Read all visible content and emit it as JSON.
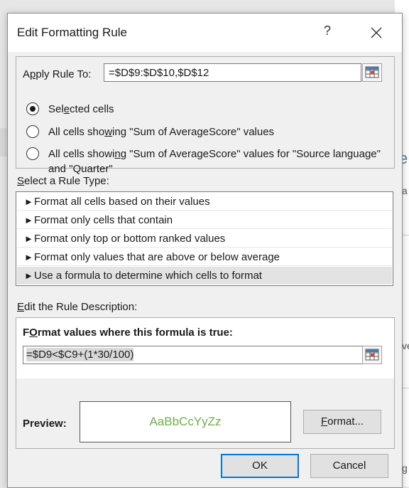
{
  "dialog": {
    "title": "Edit Formatting Rule",
    "help_label": "?"
  },
  "apply": {
    "label_prefix": "A",
    "label_ul": "p",
    "label_rest": "ply Rule To:",
    "value": "=$D$9:$D$10,$D$12"
  },
  "scope_options": [
    {
      "pre": "Sel",
      "ul": "e",
      "post": "cted cells",
      "checked": true
    },
    {
      "pre": "All cells sho",
      "ul": "w",
      "post": "ing \"Sum of AverageScore\" values",
      "checked": false
    },
    {
      "pre": "All cells showi",
      "ul": "n",
      "post": "g \"Sum of AverageScore\" values for \"Source language\"",
      "line2": "and \"Quarter\"",
      "checked": false
    }
  ],
  "rule_type": {
    "label_ul": "S",
    "label_rest": "elect a Rule Type:",
    "items": [
      "Format all cells based on their values",
      "Format only cells that contain",
      "Format only top or bottom ranked values",
      "Format only values that are above or below average",
      "Use a formula to determine which cells to format"
    ],
    "selected_index": 4,
    "arrow": "►"
  },
  "description": {
    "label_ul": "E",
    "label_rest": "dit the Rule Description:",
    "heading_ul": "O",
    "heading_pre": "F",
    "heading_rest": "rmat values where this formula is true:",
    "formula": "=$D9<$C9+(1*30/100)",
    "preview_label": "Preview:",
    "preview_sample": "AaBbCcYyZz",
    "preview_color": "#70ad47",
    "format_button_ul": "F",
    "format_button_rest": "ormat..."
  },
  "buttons": {
    "ok": "OK",
    "cancel": "Cancel"
  },
  "background": {
    "frag_e": "e",
    "frag_a": "a",
    "frag_ve": "ve",
    "frag_g": "g"
  }
}
